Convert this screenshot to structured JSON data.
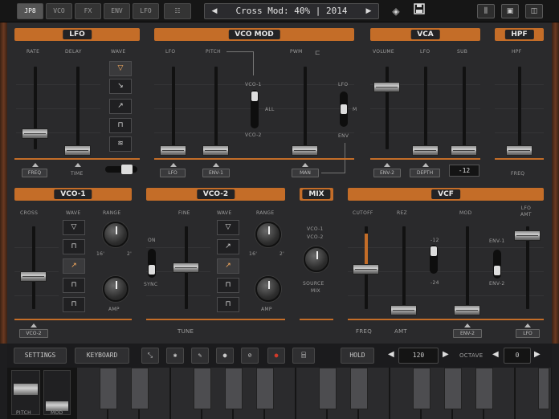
{
  "topbar": {
    "tabs": [
      {
        "label": "JP8",
        "selected": true
      },
      {
        "label": "VCO",
        "selected": false
      },
      {
        "label": "FX",
        "selected": false
      },
      {
        "label": "ENV",
        "selected": false
      },
      {
        "label": "LFO",
        "selected": false
      }
    ],
    "preset_name": "Cross Mod: 40% | 2014",
    "prev_arrow": "◀",
    "next_arrow": "▶",
    "icons": [
      "grid-icon",
      "dice-icon",
      "save-icon",
      "mixer-icon",
      "screen-icon",
      "split-icon"
    ]
  },
  "lfo": {
    "title": "LFO",
    "rate_label": "RATE",
    "delay_label": "DELAY",
    "wave_label": "WAVE",
    "freq_label": "FREQ",
    "time_label": "TIME",
    "rate_level": 0.18,
    "delay_level": 0.0,
    "waves": [
      "▽",
      "↘",
      "↗",
      "⊓",
      "≋"
    ],
    "selected_wave": 0
  },
  "vcomod": {
    "title": "VCO MOD",
    "lfo_label": "LFO",
    "pitch_label": "PITCH",
    "pwm_label": "PWM",
    "pwm_icon": "⊏",
    "lfo_badge": "LFO",
    "env1_badge": "ENV-1",
    "man_badge": "MAN",
    "vco1_label": "VCO-1",
    "all_label": "ALL",
    "vco2_label": "VCO-2",
    "lfo_sw_label": "LFO",
    "m_label": "M",
    "env_label": "ENV"
  },
  "vca": {
    "title": "VCA",
    "volume_label": "VOLUME",
    "lfo_label": "LFO",
    "sub_label": "SUB",
    "env2_badge": "ENV-2",
    "depth_badge": "DEPTH",
    "sub_value": "-12",
    "volume_level": 0.78
  },
  "hpf": {
    "title": "HPF",
    "hpf_label": "HPF",
    "freq_label": "FREQ"
  },
  "vco1": {
    "title": "VCO-1",
    "cross_label": "CROSS",
    "wave_label": "WAVE",
    "range_label": "RANGE",
    "range_lo": "16'",
    "range_hi": "2'",
    "amp_label": "AMP",
    "vco2_badge": "VCO-2",
    "waves": [
      "▽",
      "⊓",
      "↗",
      "⊓",
      "⊓"
    ],
    "cross_level": 0.4
  },
  "vco2": {
    "title": "VCO-2",
    "fine_label": "FINE",
    "wave_label": "WAVE",
    "range_label": "RANGE",
    "range_lo": "16'",
    "range_hi": "2'",
    "on_label": "ON",
    "sync_label": "SYNC",
    "amp_label": "AMP",
    "tune_label": "TUNE",
    "waves": [
      "▽",
      "↗",
      "↗",
      "⊓",
      "⊓"
    ],
    "fine_level": 0.5
  },
  "mix": {
    "title": "MIX",
    "vco1_label": "VCO-1",
    "vco2_label": "VCO-2",
    "source_label": "SOURCE",
    "mix_label": "MIX"
  },
  "vcf": {
    "title": "VCF",
    "cutoff_label": "CUTOFF",
    "rez_label": "REZ",
    "mod_label": "MOD",
    "lfo_amt_label": "LFO\nAMT",
    "freq_label": "FREQ",
    "amt_label": "AMT",
    "env2_badge": "ENV-2",
    "lfo_badge": "LFO",
    "env1_label": "ENV-1",
    "env2_label": "ENV-2",
    "sw_hi": "-12",
    "sw_lo": "-24",
    "cutoff_level": 0.5,
    "rez_level": 0.0,
    "mod_level": 0.0,
    "lfoamt_level": 0.88
  },
  "bottombar": {
    "settings": "SETTINGS",
    "keyboard": "KEYBOARD",
    "hold": "HOLD",
    "bpm": "120",
    "octave_label": "OCTAVE",
    "octave_value": "0"
  },
  "keyboard": {
    "pitch_label": "PITCH",
    "mod_label": "MOD"
  }
}
